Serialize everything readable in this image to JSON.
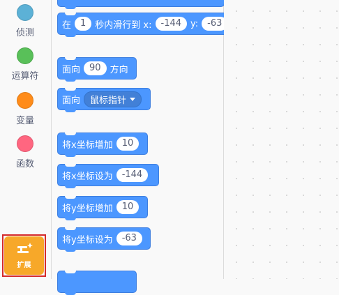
{
  "categories": [
    {
      "label": "侦测",
      "color": "#5cb1d6"
    },
    {
      "label": "运算符",
      "color": "#59c059"
    },
    {
      "label": "变量",
      "color": "#ff8c1a"
    },
    {
      "label": "函数",
      "color": "#ff6680"
    }
  ],
  "extension": {
    "label": "扩展",
    "color": "#f7a829",
    "icon": "extension-icon"
  },
  "blocks": {
    "glide": {
      "prefix": "在",
      "secs": "1",
      "mid": "秒内滑行到 x:",
      "x": "-144",
      "ylabel": "y:",
      "y": "-63"
    },
    "point_direction": {
      "prefix": "面向",
      "value": "90",
      "suffix": "方向"
    },
    "point_towards": {
      "prefix": "面向",
      "value": "鼠标指针"
    },
    "change_x": {
      "label": "将x坐标增加",
      "value": "10"
    },
    "set_x": {
      "label": "将x坐标设为",
      "value": "-144"
    },
    "change_y": {
      "label": "将y坐标增加",
      "value": "10"
    },
    "set_y": {
      "label": "将y坐标设为",
      "value": "-63"
    }
  }
}
